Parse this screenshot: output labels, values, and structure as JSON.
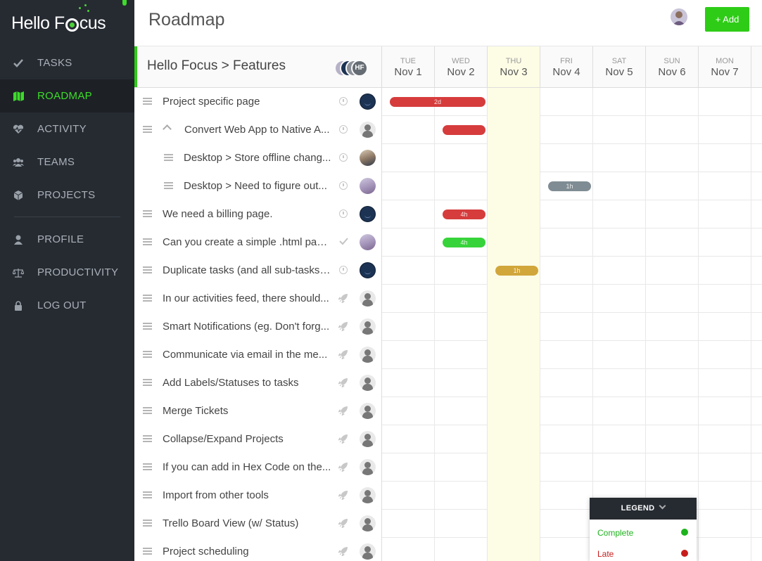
{
  "app": {
    "logo_text_1": "Hello F",
    "logo_text_2": "cus"
  },
  "sidebar": {
    "items": [
      {
        "label": "TASKS",
        "icon": "check-icon"
      },
      {
        "label": "ROADMAP",
        "icon": "map-icon",
        "active": true
      },
      {
        "label": "ACTIVITY",
        "icon": "heartbeat-icon"
      },
      {
        "label": "TEAMS",
        "icon": "users-icon"
      },
      {
        "label": "PROJECTS",
        "icon": "cube-icon"
      }
    ],
    "items2": [
      {
        "label": "PROFILE",
        "icon": "user-icon"
      },
      {
        "label": "PRODUCTIVITY",
        "icon": "balance-icon"
      },
      {
        "label": "LOG OUT",
        "icon": "lock-icon"
      }
    ]
  },
  "header": {
    "title": "Roadmap",
    "add_label": "+ Add"
  },
  "project": {
    "title": "Hello Focus > Features",
    "member_initials": "HF"
  },
  "days": [
    {
      "dow": "TUE",
      "date": "Nov 1"
    },
    {
      "dow": "WED",
      "date": "Nov 2"
    },
    {
      "dow": "THU",
      "date": "Nov 3",
      "today": true
    },
    {
      "dow": "FRI",
      "date": "Nov 4"
    },
    {
      "dow": "SAT",
      "date": "Nov 5"
    },
    {
      "dow": "SUN",
      "date": "Nov 6"
    },
    {
      "dow": "MON",
      "date": "Nov 7"
    }
  ],
  "tasks": [
    {
      "title": "Project specific page",
      "status": "clock",
      "assignee": "dark",
      "bar": {
        "start": 0,
        "span": 2,
        "color": "red",
        "label": "2d"
      }
    },
    {
      "title": "Convert Web App to Native A...",
      "status": "clock",
      "assignee": "generic",
      "parent": true,
      "bar": {
        "start": 1,
        "span": 1,
        "color": "red",
        "label": ""
      }
    },
    {
      "title": "Desktop > Store offline chang...",
      "status": "clock",
      "assignee": "photo1",
      "sub": true
    },
    {
      "title": "Desktop > Need to figure out...",
      "status": "clock",
      "assignee": "photo2",
      "sub": true,
      "bar": {
        "start": 3,
        "span": 1,
        "color": "gray",
        "label": "1h"
      }
    },
    {
      "title": "We need a billing page.",
      "status": "clock",
      "assignee": "dark",
      "bar": {
        "start": 1,
        "span": 1,
        "color": "red",
        "label": "4h"
      }
    },
    {
      "title": "Can you create a simple .html pag...",
      "status": "check",
      "assignee": "photo2",
      "bar": {
        "start": 1,
        "span": 1,
        "color": "green",
        "label": "4h"
      }
    },
    {
      "title": "Duplicate tasks (and all sub-tasks)...",
      "status": "clock",
      "assignee": "dark",
      "bar": {
        "start": 2,
        "span": 1,
        "color": "gold",
        "label": "1h"
      }
    },
    {
      "title": "In our activities feed, there should...",
      "status": "rocket",
      "assignee": "generic"
    },
    {
      "title": "Smart Notifications (eg. Don't forg...",
      "status": "rocket",
      "assignee": "generic"
    },
    {
      "title": "Communicate via email in the me...",
      "status": "rocket",
      "assignee": "generic"
    },
    {
      "title": "Add Labels/Statuses to tasks",
      "status": "rocket",
      "assignee": "generic"
    },
    {
      "title": "Merge Tickets",
      "status": "rocket",
      "assignee": "generic"
    },
    {
      "title": "Collapse/Expand Projects",
      "status": "rocket",
      "assignee": "generic"
    },
    {
      "title": "If you can add in Hex Code on the...",
      "status": "rocket",
      "assignee": "generic"
    },
    {
      "title": "Import from other tools",
      "status": "rocket",
      "assignee": "generic"
    },
    {
      "title": "Trello Board View (w/ Status)",
      "status": "rocket",
      "assignee": "generic"
    },
    {
      "title": "Project scheduling",
      "status": "rocket",
      "assignee": "generic"
    }
  ],
  "legend": {
    "title": "LEGEND",
    "items": [
      {
        "label": "Complete",
        "color": "#1db31d"
      },
      {
        "label": "Late",
        "color": "#c81c1c"
      }
    ]
  },
  "colors": {
    "accent": "#2ecc16",
    "sidebar_bg": "#262b32",
    "today_bg": "#fdfde6"
  }
}
